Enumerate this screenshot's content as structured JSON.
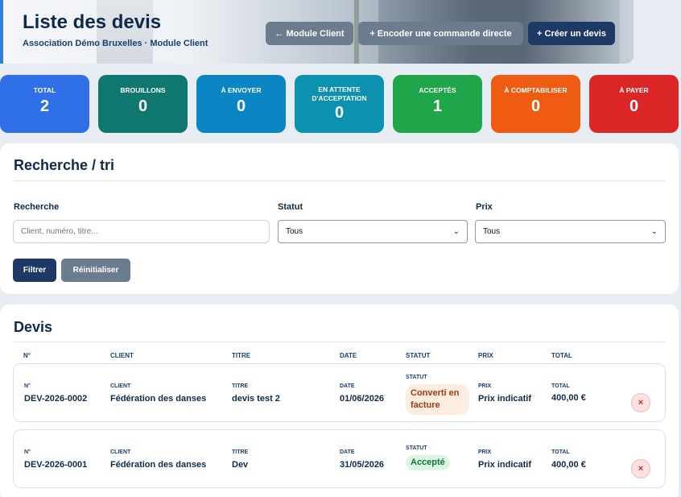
{
  "header": {
    "title": "Liste des devis",
    "subtitle": "Association Démo Bruxelles · Module Client",
    "buttons": {
      "back": "← Module Client",
      "encode": "+ Encoder une commande directe",
      "create": "+ Créer un devis"
    }
  },
  "stats": [
    {
      "label": "TOTAL",
      "value": "2",
      "color": "#2f6fe8"
    },
    {
      "label": "BROUILLONS",
      "value": "0",
      "color": "#0f7770"
    },
    {
      "label": "À ENVOYER",
      "value": "0",
      "color": "#0a86c4"
    },
    {
      "label": "EN ATTENTE D'ACCEPTATION",
      "value": "0",
      "color": "#0c91ae"
    },
    {
      "label": "ACCEPTÉS",
      "value": "1",
      "color": "#1fa64a"
    },
    {
      "label": "À COMPTABILISER",
      "value": "0",
      "color": "#ee5b11"
    },
    {
      "label": "À PAYER",
      "value": "0",
      "color": "#dc2626"
    }
  ],
  "search": {
    "title": "Recherche / tri",
    "query_label": "Recherche",
    "query_placeholder": "Client, numéro, titre...",
    "status_label": "Statut",
    "status_value": "Tous",
    "price_label": "Prix",
    "price_value": "Tous",
    "filter_button": "Filtrer",
    "reset_button": "Réinitialiser"
  },
  "devis": {
    "title": "Devis",
    "columns": [
      "N°",
      "CLIENT",
      "TITRE",
      "DATE",
      "STATUT",
      "PRIX",
      "TOTAL"
    ],
    "rows": [
      {
        "numero": "DEV-2026-0002",
        "client": "Fédération des danses",
        "titre": "devis test 2",
        "date": "01/06/2026",
        "statut": "Converti en facture",
        "prix": "Prix indicatif",
        "total": "400,00 €"
      },
      {
        "numero": "DEV-2026-0001",
        "client": "Fédération des danses",
        "titre": "Dev",
        "date": "31/05/2026",
        "statut": "Accepté",
        "prix": "Prix indicatif",
        "total": "400,00 €"
      }
    ],
    "delete_icon": "×"
  }
}
